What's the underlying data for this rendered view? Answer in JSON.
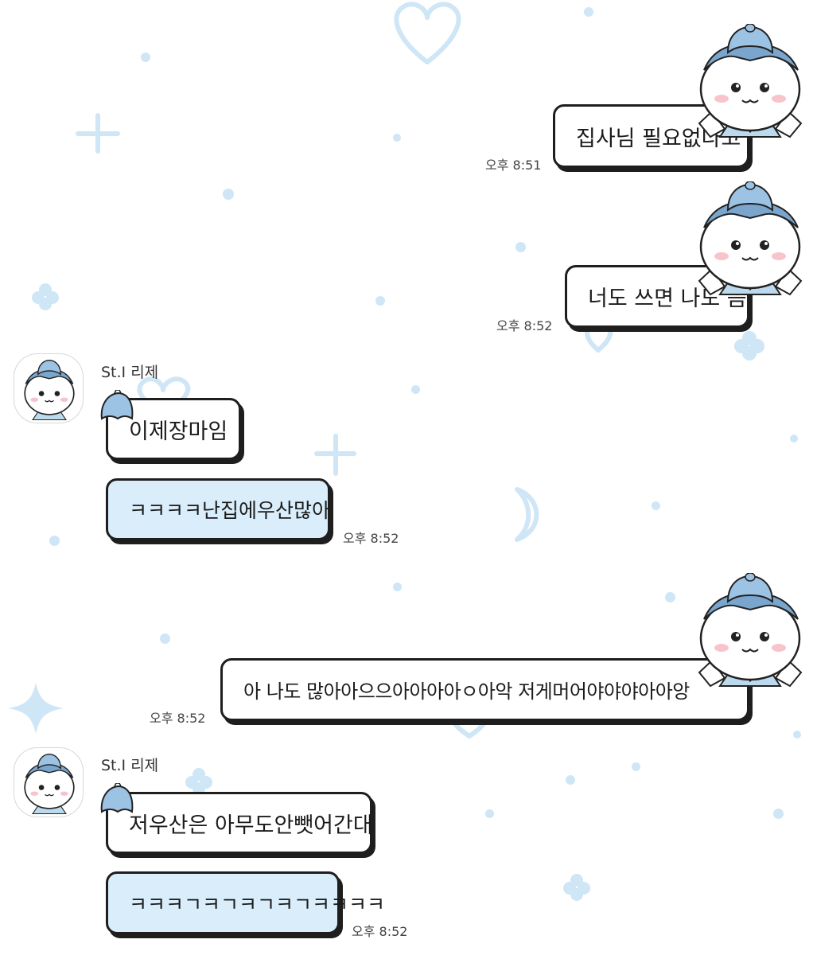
{
  "colors": {
    "background": "#ffffff",
    "decoration": "#cfe6f6",
    "bubble_white": "#ffffff",
    "bubble_blue": "#d9edfb",
    "outline": "#1e1e1e"
  },
  "messages": [
    {
      "side": "sent",
      "text": "집사님 필요없다고",
      "time": "오후 8:51",
      "icon": "bell-hat-mascot-icon"
    },
    {
      "side": "sent",
      "text": "너도 쓰면 나도 씀",
      "time": "오후 8:52",
      "icon": "bell-hat-mascot-icon"
    },
    {
      "side": "received",
      "sender": "St.I 리제",
      "avatar": "bell-hat-mascot-avatar",
      "bubbles": [
        {
          "text": "이제장마임",
          "style": "white"
        },
        {
          "text": "ㅋㅋㅋㅋ난집에우산많아",
          "style": "blue",
          "time": "오후 8:52"
        }
      ]
    },
    {
      "side": "sent",
      "text": "아 나도 많아아으으아아아아ㅇ아악 저게머어야야야아아앙",
      "time": "오후 8:52",
      "icon": "bell-hat-mascot-icon"
    },
    {
      "side": "received",
      "sender": "St.I 리제",
      "avatar": "bell-hat-mascot-avatar",
      "bubbles": [
        {
          "text": "저우산은 아무도안뺏어간대",
          "style": "white"
        },
        {
          "text": "ㅋㅋㅋㄱㅋㄱㅋㄱㅋㄱㅋㅋㅋㅋ",
          "style": "blue",
          "time": "오후 8:52"
        }
      ]
    }
  ]
}
